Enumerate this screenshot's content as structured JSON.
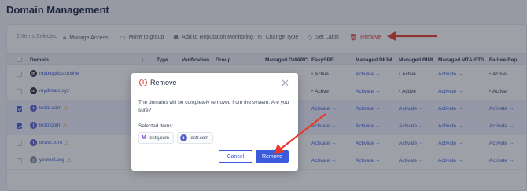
{
  "page": {
    "title": "Domain Management"
  },
  "toolbar": {
    "selected_count": "2 Items Selected",
    "actions": [
      {
        "label": "Manage Access",
        "icon": "lock-icon"
      },
      {
        "label": "Move to group",
        "icon": "folder-icon"
      },
      {
        "label": "Add to Reputation Monitoring",
        "icon": "trophy-icon"
      },
      {
        "label": "Change Type",
        "icon": "refresh-icon"
      },
      {
        "label": "Set Label",
        "icon": "tag-icon"
      },
      {
        "label": "Remove",
        "icon": "trash-icon"
      }
    ]
  },
  "table": {
    "headers": [
      "Domain",
      "Type",
      "Verification",
      "Group",
      "Managed DMARC",
      "EasySPF",
      "Managed DKIM",
      "Managed BIMI",
      "Managed MTA-STS",
      "Failure Rep"
    ],
    "sort_indicator": "↑",
    "rows": [
      {
        "domain": "myblogtips.online",
        "avatar": "m",
        "avatar_color": "#2b2f3a",
        "checked": false,
        "warn": false,
        "easyspf": "Active",
        "dkim": "Activate →",
        "bimi": "Active",
        "mtasts": "Activate →",
        "failure": "Active"
      },
      {
        "domain": "mydmarc.xyz",
        "avatar": "m",
        "avatar_color": "#2b2f3a",
        "checked": false,
        "warn": false,
        "easyspf": "Active",
        "dkim": "Activate →",
        "bimi": "Active",
        "mtasts": "Activate →",
        "failure": "Active"
      },
      {
        "domain": "testq.com",
        "avatar": "t",
        "avatar_color": "#5a63c9",
        "checked": true,
        "warn": true,
        "easyspf": "Activate →",
        "dkim": "Activate →",
        "bimi": "Activate →",
        "mtasts": "Activate →",
        "failure": "Activate →"
      },
      {
        "domain": "testr.com",
        "avatar": "t",
        "avatar_color": "#5a63c9",
        "checked": true,
        "warn": true,
        "easyspf": "Activate →",
        "dkim": "Activate →",
        "bimi": "Activate →",
        "mtasts": "Activate →",
        "failure": "Activate →"
      },
      {
        "domain": "testw.com",
        "avatar": "t",
        "avatar_color": "#5a63c9",
        "checked": false,
        "warn": true,
        "easyspf": "Activate →",
        "dkim": "Activate →",
        "bimi": "Activate →",
        "mtasts": "Activate →",
        "failure": "Activate →"
      },
      {
        "domain": "yestest.org",
        "avatar": "y",
        "avatar_color": "#8a8f99",
        "checked": false,
        "warn": true,
        "easyspf": "Activate →",
        "dkim": "Activate →",
        "bimi": "Activate →",
        "mtasts": "Activate →",
        "failure": "Activate →"
      }
    ]
  },
  "modal": {
    "title": "Remove",
    "message": "The domains will be completely removed from the system. Are you sure?",
    "selected_label": "Selected items:",
    "chips": [
      {
        "label": "testq.com",
        "icon": "m-logo-icon",
        "color": "#7b2ff7"
      },
      {
        "label": "testr.com",
        "icon": "t-avatar-icon",
        "color": "#5a63c9"
      }
    ],
    "cancel_label": "Cancel",
    "remove_label": "Remove"
  },
  "colors": {
    "accent": "#3b5bdb",
    "danger": "#d0352c",
    "annotation_arrow": "#e8392a"
  }
}
